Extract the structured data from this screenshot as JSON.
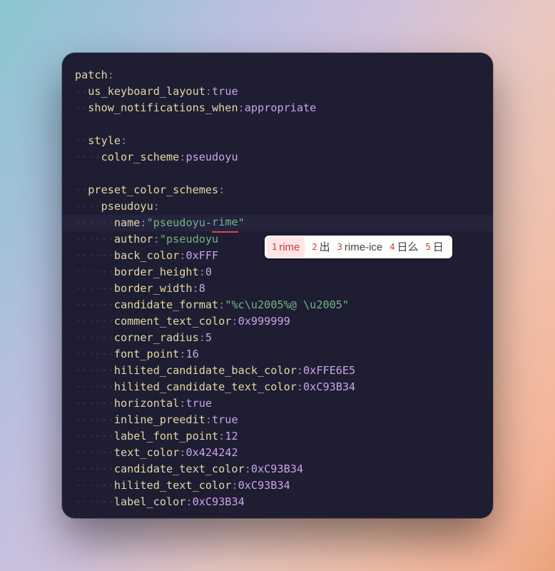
{
  "code": {
    "l1_key": "patch",
    "l2_key": "us_keyboard_layout",
    "l2_val": "true",
    "l3_key": "show_notifications_when",
    "l3_val": "appropriate",
    "l5_key": "style",
    "l6_key": "color_scheme",
    "l6_val": "pseudoyu",
    "l8_key": "preset_color_schemes",
    "l9_key": "pseudoyu",
    "l10_key": "name",
    "l10_q1": "\"",
    "l10_v1": "pseudoyu",
    "l10_dash": "-",
    "l10_v2": "rime",
    "l10_q2": "\"",
    "l11_key": "author",
    "l11_val": "\"pseudoyu",
    "l12_key": "back_color",
    "l12_val": "0xFFF",
    "l13_key": "border_height",
    "l13_val": "0",
    "l14_key": "border_width",
    "l14_val": "8",
    "l15_key": "candidate_format",
    "l15_val": "\"%c\\u2005%@ \\u2005\"",
    "l16_key": "comment_text_color",
    "l16_val": "0x999999",
    "l17_key": "corner_radius",
    "l17_val": "5",
    "l18_key": "font_point",
    "l18_val": "16",
    "l19_key": "hilited_candidate_back_color",
    "l19_val": "0xFFE6E5",
    "l20_key": "hilited_candidate_text_color",
    "l20_val": "0xC93B34",
    "l21_key": "horizontal",
    "l21_val": "true",
    "l22_key": "inline_preedit",
    "l22_val": "true",
    "l23_key": "label_font_point",
    "l23_val": "12",
    "l24_key": "text_color",
    "l24_val": "0x424242",
    "l25_key": "candidate_text_color",
    "l25_val": "0xC93B34",
    "l26_key": "hilited_text_color",
    "l26_val": "0xC93B34",
    "l27_key": "label_color",
    "l27_val": "0xC93B34"
  },
  "colon": ":",
  "ime": {
    "candidates": [
      {
        "n": "1",
        "t": "rime",
        "selected": true
      },
      {
        "n": "2",
        "t": "出"
      },
      {
        "n": "3",
        "t": "rime-ice"
      },
      {
        "n": "4",
        "t": "日么"
      },
      {
        "n": "5",
        "t": "日"
      }
    ]
  }
}
